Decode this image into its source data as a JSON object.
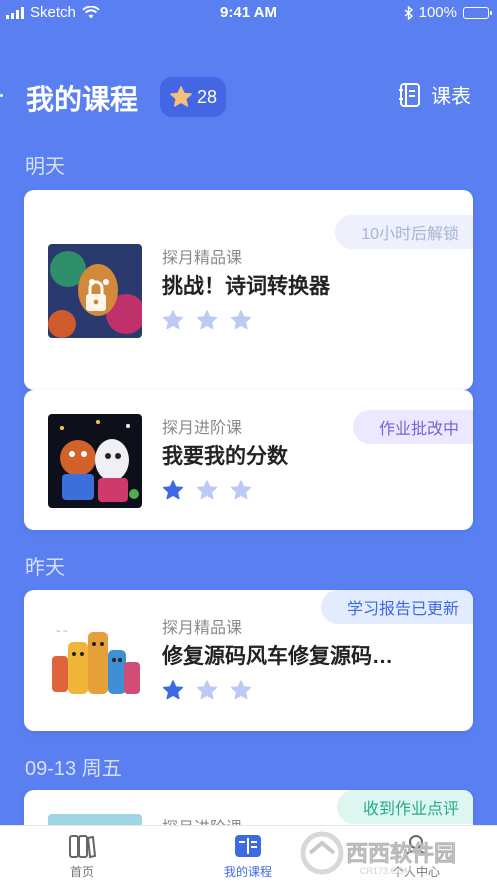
{
  "status_bar": {
    "carrier": "Sketch",
    "time": "9:41 AM",
    "battery": "100%"
  },
  "header": {
    "title": "我的课程",
    "star_count": "28",
    "timetable_label": "课表"
  },
  "sections": [
    {
      "label": "明天"
    },
    {
      "label": "昨天"
    },
    {
      "label": "09-13 周五"
    }
  ],
  "courses": [
    {
      "category": "探月精品课",
      "title": "挑战！诗词转换器",
      "tag": "10小时后解锁",
      "tag_style": "muted",
      "stars_filled": 0,
      "stars_total": 3,
      "locked": true
    },
    {
      "category": "探月进阶课",
      "title": "我要我的分数",
      "tag": "作业批改中",
      "tag_style": "purple",
      "stars_filled": 1,
      "stars_total": 3,
      "locked": false
    },
    {
      "category": "探月精品课",
      "title": "修复源码风车修复源码…",
      "tag": "学习报告已更新",
      "tag_style": "blue",
      "stars_filled": 1,
      "stars_total": 3,
      "locked": false
    },
    {
      "category": "探月进阶课",
      "title": "",
      "tag": "收到作业点评",
      "tag_style": "green",
      "stars_filled": 0,
      "stars_total": 3,
      "locked": false
    }
  ],
  "tab_bar": {
    "items": [
      {
        "label": "首页",
        "icon": "books-icon",
        "active": false
      },
      {
        "label": "我的课程",
        "icon": "open-book-icon",
        "active": true
      },
      {
        "label": "个人中心",
        "icon": "profile-icon",
        "active": false
      }
    ]
  },
  "watermark": {
    "text": "西西软件园",
    "sub": "CR173.COM"
  },
  "colors": {
    "background": "#5a7ff0",
    "accent": "#3d6ae4",
    "star_filled": "#3d6ae4",
    "star_empty": "#bccaf4",
    "badge_star": "#f5c07a"
  }
}
